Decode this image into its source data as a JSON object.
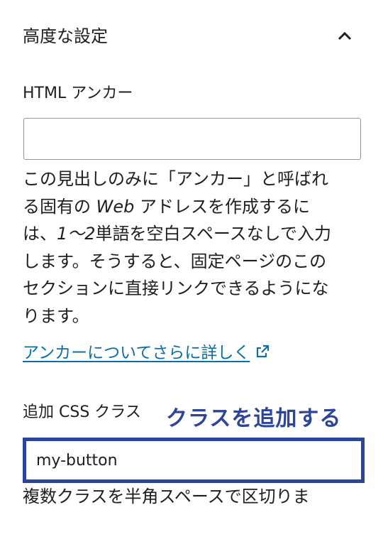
{
  "panel": {
    "section_title": "高度な設定",
    "anchor_label": "HTML アンカー",
    "anchor_value": "",
    "anchor_help": {
      "line1": "この見出しのみに「アンカー」と呼ばれ",
      "line2_a": "る固有の ",
      "line2_em": "Web",
      "line2_b": " アドレスを作成するに",
      "line3_a": "は、",
      "line3_em": "1〜2",
      "line3_b": "単語を空白スペースなしで入力",
      "line4": "します。そうすると、固定ページのこの",
      "line5": "セクションに直接リンクできるようにな",
      "line6": "ります。"
    },
    "learn_more_link": "アンカーについてさらに詳しく",
    "css_label": "追加 CSS クラス",
    "css_value": "my-button",
    "css_help": "複数クラスを半角スペースで区切りま"
  },
  "annotation": {
    "callout": "クラスを追加する",
    "color": "#2b459a"
  },
  "icons": {
    "collapse": "chevron-up-icon",
    "external": "external-link-icon"
  }
}
